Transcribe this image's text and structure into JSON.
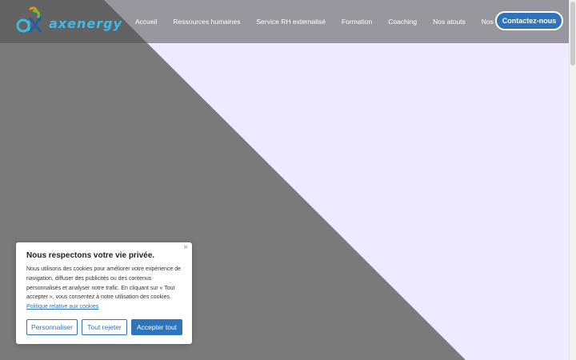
{
  "header": {
    "brand": "axenergy",
    "nav": [
      "Accueil",
      "Ressources humaines",
      "Service RH externalisé",
      "Formation",
      "Coaching",
      "Nos atouts",
      "Nos tarifs"
    ],
    "contact_label": "Contactez-nous"
  },
  "cookie_banner": {
    "close_label": "×",
    "title": "Nous respectons votre vie privée.",
    "text": "Nous utilisons des cookies pour améliorer votre expérience de navigation, diffuser des publicités ou des contenus personnalisés et analyser notre trafic. En cliquant sur « Tout accepter », vous consentez à notre utilisation des cookies.",
    "link": "Politique relative aux cookies",
    "buttons": {
      "customize": "Personnaliser",
      "reject": "Tout rejeter",
      "accept": "Accepter tout"
    }
  },
  "colors": {
    "accent": "#2f73b8",
    "background_gray": "#7a7a7a",
    "background_lavender": "#efeaff",
    "logo_blue": "#3dbbe8",
    "logo_orange": "#f28c1a",
    "logo_green": "#6bbf3a"
  }
}
